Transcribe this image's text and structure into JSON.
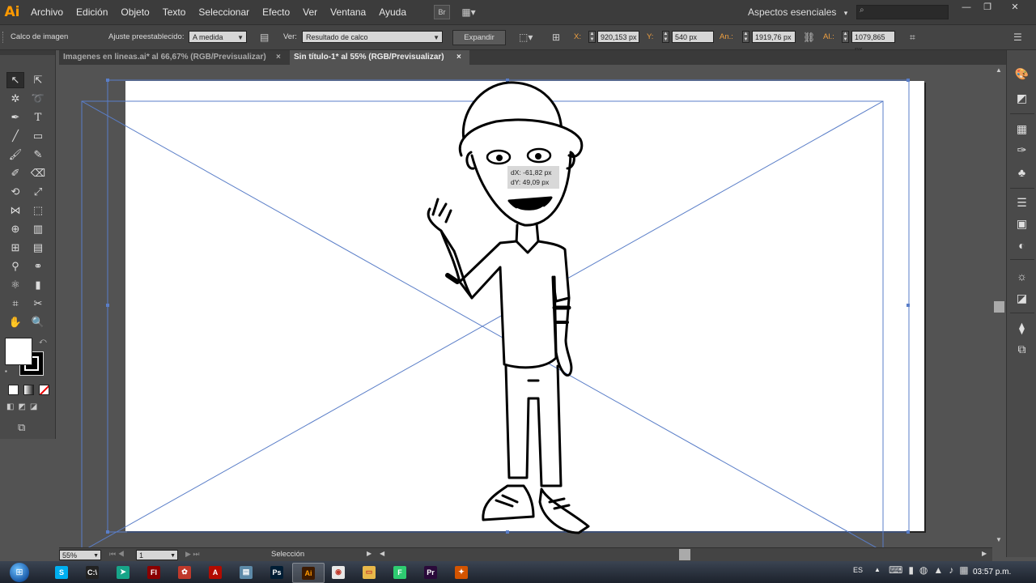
{
  "app": {
    "logo": "Ai"
  },
  "menu": [
    "Archivo",
    "Edición",
    "Objeto",
    "Texto",
    "Seleccionar",
    "Efecto",
    "Ver",
    "Ventana",
    "Ayuda"
  ],
  "menu_buttons": {
    "bridge": "Br",
    "arrange": "▦▾"
  },
  "workspace": {
    "label": "Aspectos esenciales",
    "arrow": "▾"
  },
  "window_controls": {
    "minimize": "—",
    "restore": "❐",
    "close": "✕"
  },
  "control_bar": {
    "panel_name": "Calco de imagen",
    "preset_label": "Ajuste preestablecido:",
    "preset_value": "A medida",
    "view_label": "Ver:",
    "view_value": "Resultado de calco",
    "expand_button": "Expandir",
    "x_label": "X:",
    "x_value": "920,153 px",
    "y_label": "Y:",
    "y_value": "540 px",
    "w_label": "An.:",
    "w_value": "1919,76 px",
    "h_label": "Al.:",
    "h_value": "1079,865 px"
  },
  "tabs": [
    {
      "label": "Imagenes en lineas.ai* al 66,67% (RGB/Previsualizar)",
      "close": "×",
      "active": false
    },
    {
      "label": "Sin título-1* al 55% (RGB/Previsualizar)",
      "close": "×",
      "active": true
    }
  ],
  "readout": {
    "dx": "dX: -61,82 px",
    "dy": "dY: 49,09 px"
  },
  "status_bar": {
    "zoom": "55%",
    "artboard": "1",
    "tool": "Selección"
  },
  "taskbar": {
    "apps": [
      {
        "name": "skype",
        "glyph": "S",
        "color": "#00aff0"
      },
      {
        "name": "cmd",
        "glyph": "C:\\",
        "color": "#222222"
      },
      {
        "name": "app-3",
        "glyph": "➤",
        "color": "#17a589"
      },
      {
        "name": "flash",
        "glyph": "Fl",
        "color": "#8b0000"
      },
      {
        "name": "app-5",
        "glyph": "✿",
        "color": "#c0392b"
      },
      {
        "name": "acrobat",
        "glyph": "A",
        "color": "#b30b00"
      },
      {
        "name": "notepad",
        "glyph": "▤",
        "color": "#5d8aa8"
      },
      {
        "name": "photoshop",
        "glyph": "Ps",
        "color": "#001d34"
      },
      {
        "name": "illustrator",
        "glyph": "Ai",
        "color": "#3d1a00"
      },
      {
        "name": "chrome",
        "glyph": "◉",
        "color": "#e8e8e8"
      },
      {
        "name": "explorer",
        "glyph": "▭",
        "color": "#e8b84a"
      },
      {
        "name": "app-12",
        "glyph": "F",
        "color": "#2ecc71"
      },
      {
        "name": "premiere",
        "glyph": "Pr",
        "color": "#2a0a3a"
      },
      {
        "name": "app-14",
        "glyph": "✦",
        "color": "#d35400"
      }
    ],
    "language": "ES",
    "time": "03:57 p.m."
  }
}
